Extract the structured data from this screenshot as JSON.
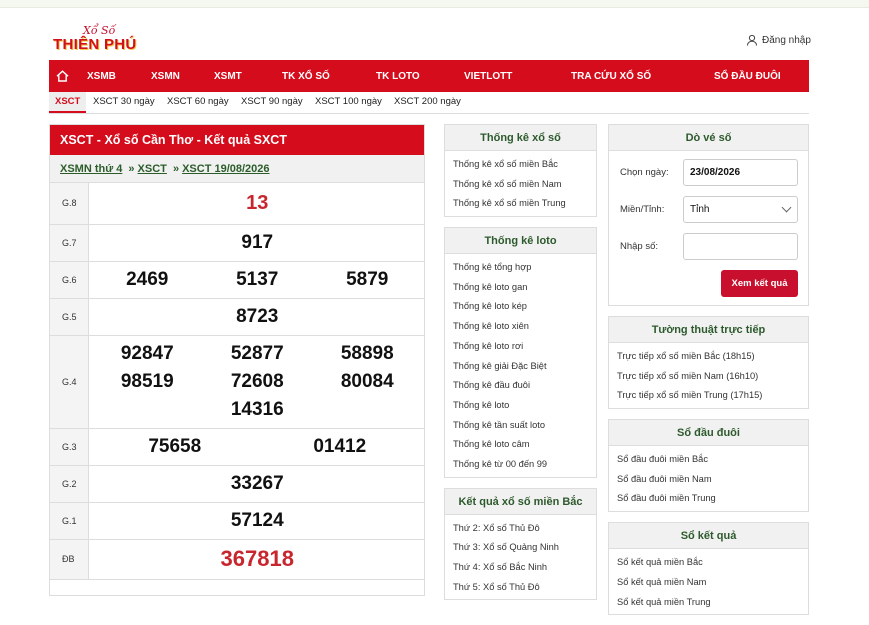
{
  "logo": {
    "script": "Xổ Số",
    "brand": "THIÊN PHÚ"
  },
  "header": {
    "login_label": "Đăng nhập"
  },
  "nav": {
    "items": [
      "XSMB",
      "XSMN",
      "XSMT",
      "TK XỔ SỐ",
      "TK LOTO",
      "VIETLOTT",
      "TRA CỨU XỔ SỐ",
      "SỔ ĐẦU ĐUÔI"
    ]
  },
  "subnav": {
    "items": [
      "XSCT",
      "XSCT 30 ngày",
      "XSCT 60 ngày",
      "XSCT 90 ngày",
      "XSCT 100 ngày",
      "XSCT 200 ngày"
    ]
  },
  "results": {
    "title": "XSCT - Xổ số Cần Thơ - Kết quả SXCT",
    "breadcrumb": [
      "XSMN thứ 4",
      "XSCT",
      "XSCT 19/08/2026"
    ],
    "breadcrumb_sep": "»",
    "rows": [
      {
        "label": "G.8",
        "numbers": [
          "13"
        ]
      },
      {
        "label": "G.7",
        "numbers": [
          "917"
        ]
      },
      {
        "label": "G.6",
        "numbers": [
          "2469",
          "5137",
          "5879"
        ]
      },
      {
        "label": "G.5",
        "numbers": [
          "8723"
        ]
      },
      {
        "label": "G.4",
        "numbers": [
          "92847",
          "52877",
          "58898",
          "98519",
          "72608",
          "80084",
          "14316"
        ]
      },
      {
        "label": "G.3",
        "numbers": [
          "75658",
          "01412"
        ]
      },
      {
        "label": "G.2",
        "numbers": [
          "33267"
        ]
      },
      {
        "label": "G.1",
        "numbers": [
          "57124"
        ]
      },
      {
        "label": "ĐB",
        "numbers": [
          "367818"
        ]
      }
    ]
  },
  "stats_box": {
    "title": "Thống kê xổ số",
    "items": [
      "Thống kê xổ số miền Bắc",
      "Thống kê xổ số miền Nam",
      "Thống kê xổ số miền Trung"
    ]
  },
  "loto_box": {
    "title": "Thống kê loto",
    "items": [
      "Thống kê tổng hợp",
      "Thống kê loto gan",
      "Thống kê loto kép",
      "Thống kê loto xiên",
      "Thống kê loto rơi",
      "Thống kê giải Đặc Biệt",
      "Thống kê đầu đuôi",
      "Thống kê loto",
      "Thống kê tần suất loto",
      "Thống kê loto câm",
      "Thống kê từ 00 đến 99"
    ]
  },
  "north_box": {
    "title": "Kết quả xổ số miền Bắc",
    "items": [
      "Thứ 2: Xổ số Thủ Đô",
      "Thứ 3: Xổ số Quảng Ninh",
      "Thứ 4: Xổ số Bắc Ninh",
      "Thứ 5: Xổ số Thủ Đô"
    ]
  },
  "ticket": {
    "title": "Dò vé số",
    "date_label": "Chọn ngày:",
    "date_value": "23/08/2026",
    "province_label": "Miền/Tỉnh:",
    "province_value": "Tỉnh",
    "number_label": "Nhập số:",
    "number_value": "",
    "submit_label": "Xem kết quả"
  },
  "live_box": {
    "title": "Tường thuật trực tiếp",
    "items": [
      "Trực tiếp xổ số miền Bắc (18h15)",
      "Trực tiếp xổ số miền Nam (16h10)",
      "Trực tiếp xổ số miền Trung (17h15)"
    ]
  },
  "headtail_box": {
    "title": "Sổ đầu đuôi",
    "items": [
      "Sổ đầu đuôi miền Bắc",
      "Sổ đầu đuôi miền Nam",
      "Sổ đầu đuôi miền Trung"
    ]
  },
  "results_book_box": {
    "title": "Sổ kết quả",
    "items": [
      "Sổ kết quả miền Bắc",
      "Sổ kết quả miền Nam",
      "Sổ kết quả miền Trung"
    ]
  },
  "colors": {
    "primary": "#d50c1c",
    "box_title": "#2d5a2d",
    "special": "#c8262f"
  }
}
